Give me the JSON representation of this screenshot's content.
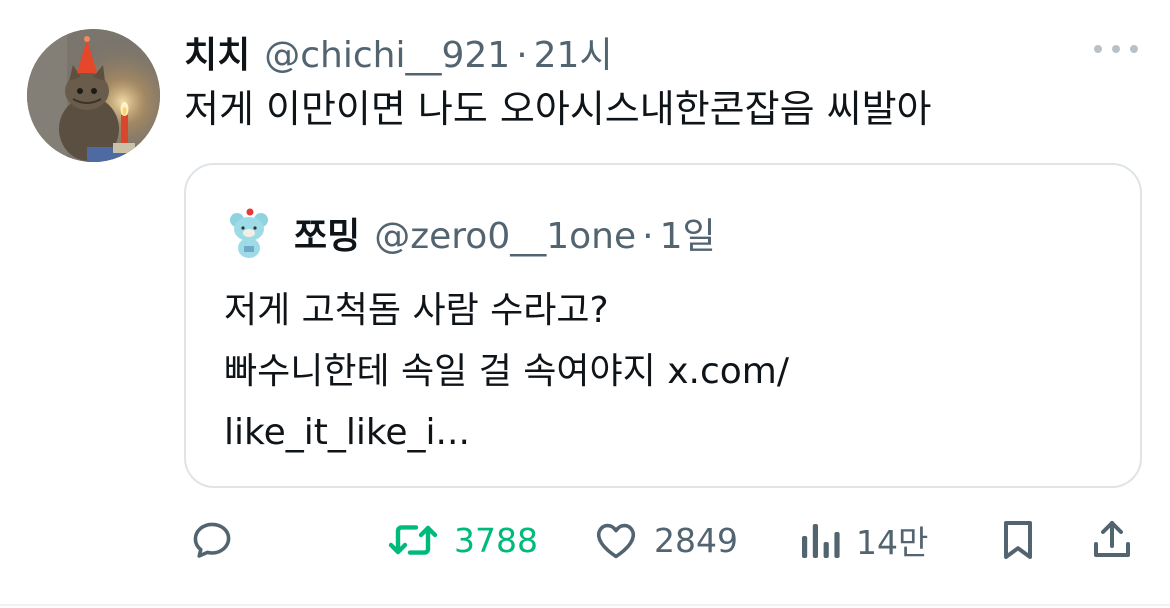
{
  "tweet": {
    "author_name": "치치",
    "author_handle": "@chichi__921",
    "separator": "·",
    "time": "21시",
    "text": "저게 이만이면 나도 오아시스내한콘잡음 씨발아"
  },
  "quoted": {
    "author_name": "쪼밍",
    "author_handle": "@zero0__1one",
    "separator": "·",
    "time": "1일",
    "lines": [
      "저게 고척돔 사람 수라고?",
      "빠수니한테 속일 걸 속여야지 x.com/",
      "like_it_like_i..."
    ]
  },
  "actions": {
    "reply_icon": "reply-icon",
    "retweet_icon": "retweet-icon",
    "retweet_count": "3788",
    "like_icon": "heart-icon",
    "like_count": "2849",
    "views_icon": "views-icon",
    "views_count": "14만",
    "bookmark_icon": "bookmark-icon",
    "share_icon": "share-icon"
  },
  "colors": {
    "text_primary": "#0f1419",
    "text_secondary": "#536471",
    "retweet_active": "#00ba7c",
    "border": "#dfe4e8"
  }
}
